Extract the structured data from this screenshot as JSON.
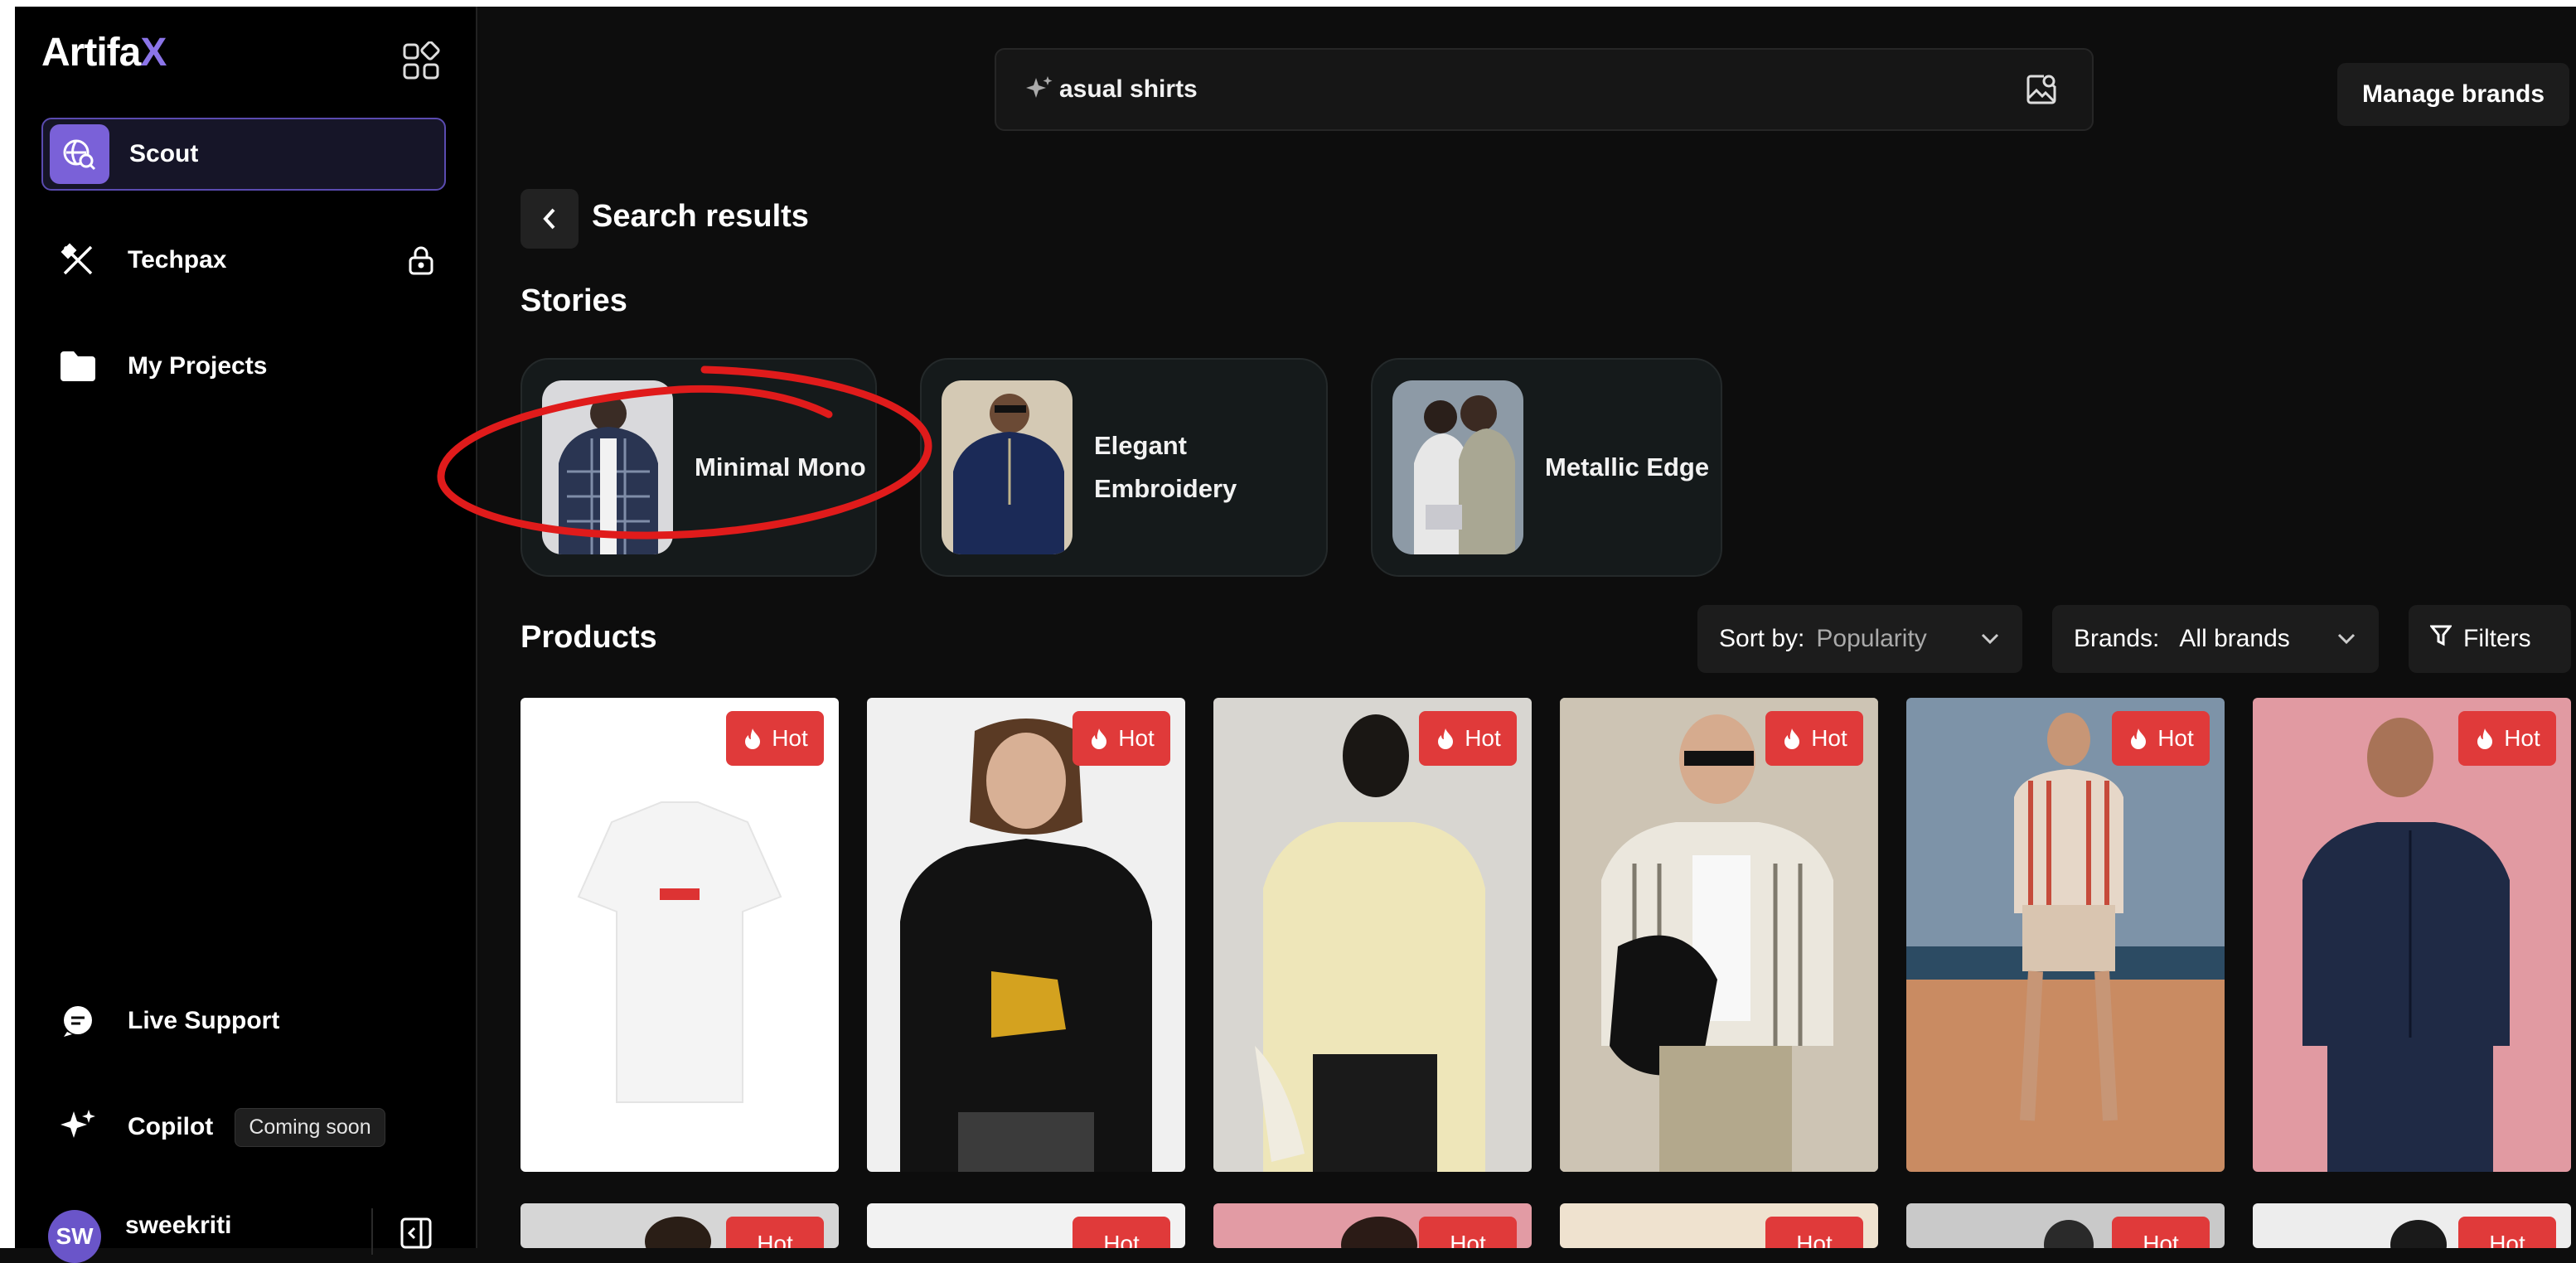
{
  "app": {
    "logo_main": "Artifa",
    "logo_accent": "X"
  },
  "sidebar": {
    "items": [
      {
        "label": "Scout",
        "active": true,
        "icon": "globe-search-icon"
      },
      {
        "label": "Techpax",
        "locked": true,
        "icon": "tools-icon"
      },
      {
        "label": "My Projects",
        "icon": "folder-icon"
      }
    ],
    "bottom": [
      {
        "label": "Live Support",
        "icon": "chat-icon"
      },
      {
        "label": "Copilot",
        "badge": "Coming soon",
        "icon": "sparkle-icon"
      }
    ],
    "user": {
      "initials": "SW",
      "name": "sweekriti"
    }
  },
  "search": {
    "value": "asual shirts",
    "placeholder": ""
  },
  "header": {
    "manage_brands": "Manage brands"
  },
  "results": {
    "title": "Search results"
  },
  "stories": {
    "title": "Stories",
    "items": [
      {
        "label": "Minimal Mono"
      },
      {
        "label_line1": "Elegant",
        "label_line2": "Embroidery"
      },
      {
        "label": "Metallic Edge"
      }
    ]
  },
  "products": {
    "title": "Products",
    "sort_label": "Sort by:",
    "sort_value": "Popularity",
    "brands_label": "Brands:",
    "brands_value": "All brands",
    "filters_label": "Filters",
    "hot_label": "Hot"
  },
  "colors": {
    "accent": "#7a61d8",
    "hot": "#e03a3a",
    "annotation": "#e01b1b"
  }
}
